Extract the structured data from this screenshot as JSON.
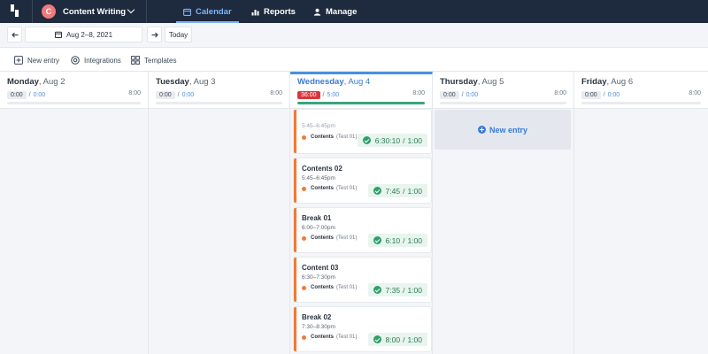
{
  "workspace": {
    "avatar_letter": "C",
    "name": "Content Writing"
  },
  "nav": {
    "calendar": "Calendar",
    "reports": "Reports",
    "manage": "Manage"
  },
  "datebar": {
    "range": "Aug 2–8, 2021",
    "today": "Today"
  },
  "toolbar": {
    "new_entry": "New entry",
    "integrations": "Integrations",
    "templates": "Templates"
  },
  "days": [
    {
      "name": "Monday",
      "date": "Aug 2",
      "tracked": "0:00",
      "planned": "0:00",
      "capacity": "8:00",
      "progress": 0
    },
    {
      "name": "Tuesday",
      "date": "Aug 3",
      "tracked": "0:00",
      "planned": "0:00",
      "capacity": "8:00",
      "progress": 0
    },
    {
      "name": "Wednesday",
      "date": "Aug 4",
      "tracked": "36:00",
      "planned": "5:00",
      "capacity": "8:00",
      "progress": 1
    },
    {
      "name": "Thursday",
      "date": "Aug 5",
      "tracked": "0:00",
      "planned": "0:00",
      "capacity": "8:00",
      "progress": 0
    },
    {
      "name": "Friday",
      "date": "Aug 6",
      "tracked": "0:00",
      "planned": "0:00",
      "capacity": "8:00",
      "progress": 0
    }
  ],
  "entries": [
    {
      "title": "",
      "time": "5:45–6:45pm",
      "project": "Contents",
      "client": "(Test 01)",
      "tracked": "6:30:10",
      "planned": "1:00"
    },
    {
      "title": "Contents 02",
      "time": "5:45–6:45pm",
      "project": "Contents",
      "client": "(Test 01)",
      "tracked": "7:45",
      "planned": "1:00"
    },
    {
      "title": "Break 01",
      "time": "6:00–7:00pm",
      "project": "Contents",
      "client": "(Test 01)",
      "tracked": "6:10",
      "planned": "1:00"
    },
    {
      "title": "Content 03",
      "time": "6:30–7:30pm",
      "project": "Contents",
      "client": "(Test 01)",
      "tracked": "7:35",
      "planned": "1:00"
    },
    {
      "title": "Break 02",
      "time": "7:30–8:30pm",
      "project": "Contents",
      "client": "(Test 01)",
      "tracked": "8:00",
      "planned": "1:00"
    }
  ],
  "new_entry_slot": {
    "label": "New entry"
  },
  "colors": {
    "nav_bg": "#1e2a3e",
    "accent": "#3a7bd5",
    "entry_border": "#f07a35",
    "over_badge": "#d9363e",
    "success": "#2f9e6a"
  }
}
